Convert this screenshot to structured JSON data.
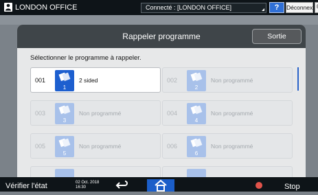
{
  "topbar": {
    "office": "LONDON OFFICE",
    "connection": "Connecté : [LONDON OFFICE]",
    "help": "?",
    "logout": "Déconnexion"
  },
  "dialog": {
    "title": "Rappeler programme",
    "exit": "Sortie",
    "instruction": "Sélectionner le programme à rappeler."
  },
  "programs": [
    {
      "num": "001",
      "icon_num": "1",
      "label": "2 sided",
      "active": true
    },
    {
      "num": "002",
      "icon_num": "2",
      "label": "Non programmé",
      "active": false
    },
    {
      "num": "003",
      "icon_num": "3",
      "label": "Non programmé",
      "active": false
    },
    {
      "num": "004",
      "icon_num": "4",
      "label": "Non programmé",
      "active": false
    },
    {
      "num": "005",
      "icon_num": "5",
      "label": "Non programmé",
      "active": false
    },
    {
      "num": "006",
      "icon_num": "6",
      "label": "Non programmé",
      "active": false
    }
  ],
  "bottombar": {
    "status": "Vérifier l'état",
    "date": "02 Oct. 2018",
    "time": "16:30",
    "stop": "Stop"
  },
  "colors": {
    "accent": "#1d5fcf",
    "topbar": "#0e1418",
    "dialog_header": "#3f4549"
  }
}
